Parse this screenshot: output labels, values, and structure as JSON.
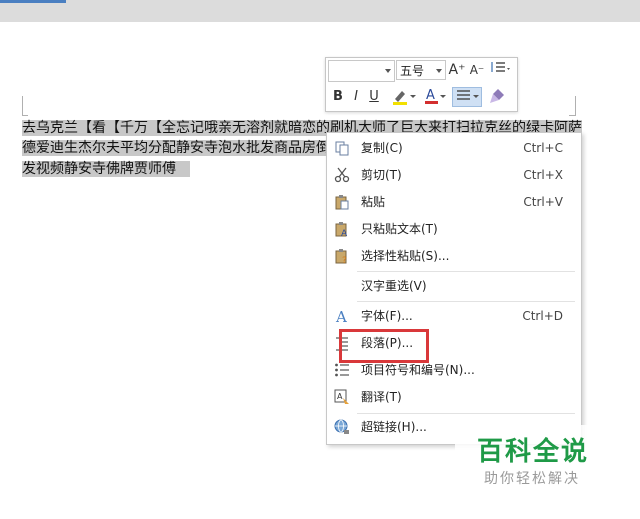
{
  "document": {
    "lines": [
      "去乌克兰【看【千万【全忘记哦亲无溶剂就暗恋的刷机大师了巨大来打扫拉克丝的绿卡阿萨",
      "德爱迪生杰尔夫平均分配静安寺泡水批发商品房倒",
      "发视频静安寺佛牌贾师傅"
    ]
  },
  "mini_toolbar": {
    "font_name": "",
    "font_size": "五号",
    "grow_font": "A⁺",
    "shrink_font": "A⁻",
    "bold": "B",
    "italic": "I",
    "underline": "U"
  },
  "context_menu": {
    "items": [
      {
        "label": "复制(C)",
        "shortcut": "Ctrl+C",
        "icon": "copy-icon"
      },
      {
        "label": "剪切(T)",
        "shortcut": "Ctrl+X",
        "icon": "scissors-icon"
      },
      {
        "label": "粘贴",
        "shortcut": "Ctrl+V",
        "icon": "paste-icon"
      },
      {
        "label": "只粘贴文本(T)",
        "shortcut": "",
        "icon": "paste-text-icon"
      },
      {
        "label": "选择性粘贴(S)...",
        "shortcut": "",
        "icon": "paste-special-icon"
      },
      {
        "label": "汉字重选(V)",
        "shortcut": "",
        "icon": ""
      },
      {
        "label": "字体(F)...",
        "shortcut": "Ctrl+D",
        "icon": "font-icon"
      },
      {
        "label": "段落(P)...",
        "shortcut": "",
        "icon": "paragraph-icon"
      },
      {
        "label": "项目符号和编号(N)...",
        "shortcut": "",
        "icon": "bullets-icon"
      },
      {
        "label": "翻译(T)",
        "shortcut": "",
        "icon": "translate-icon"
      },
      {
        "label": "超链接(H)...",
        "shortcut": "",
        "icon": "hyperlink-icon"
      }
    ]
  },
  "watermark": {
    "title": "百科全说",
    "subtitle": "助你轻松解决"
  },
  "colors": {
    "highlight": "#c8c8c8",
    "callout_red": "#d9383a",
    "watermark_green": "#1f9a47"
  }
}
